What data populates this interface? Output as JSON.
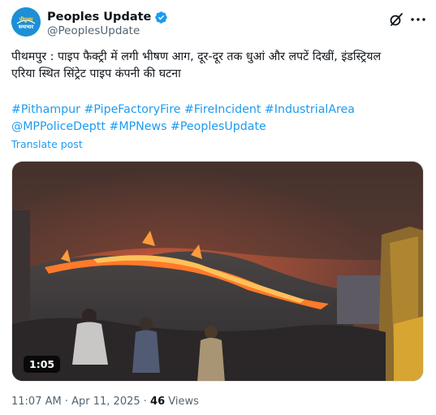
{
  "author": {
    "display_name": "Peoples Update",
    "handle": "@PeoplesUpdate",
    "avatar_text": "पीपुल्स समाचार",
    "avatar_color": "#1d8fd6",
    "verified_color": "#1d9bf0"
  },
  "header_actions": {
    "grok_icon": "grok-icon",
    "more_icon": "more-icon"
  },
  "post": {
    "text": "पीथमपुर : पाइप फैक्ट्री में लगी भीषण आग, दूर-दूर तक धुआं और लपटें दिखीं, इंडस्ट्रियल\nएरिया स्थित सिंट्रेट पाइप कंपनी की घटना",
    "hashtags": [
      "#Pithampur",
      "#PipeFactoryFire",
      "#FireIncident",
      "#IndustrialArea",
      "@MPPoliceDeptt",
      "#MPNews",
      "#PeoplesUpdate"
    ],
    "translate_label": "Translate post",
    "link_color": "#1d9bf0"
  },
  "media": {
    "duration": "1:05"
  },
  "meta": {
    "time": "11:07 AM",
    "separator": " · ",
    "date": "Apr 11, 2025",
    "views_count": "46",
    "views_label": " Views"
  }
}
